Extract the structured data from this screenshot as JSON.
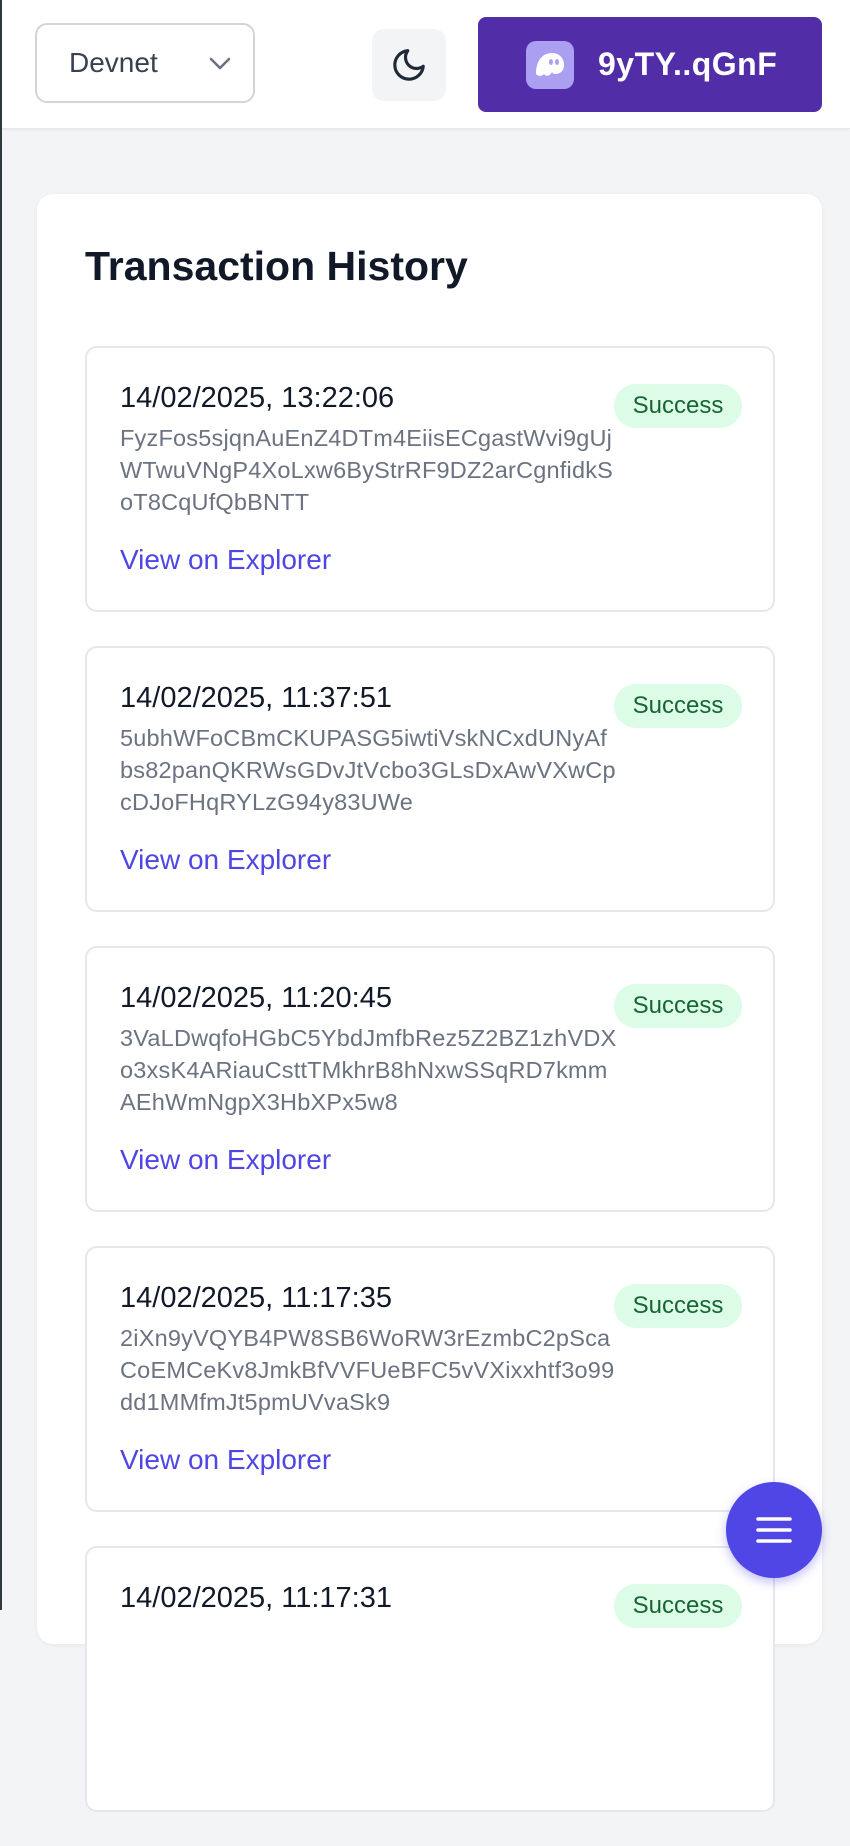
{
  "header": {
    "network_selector": {
      "value": "Devnet",
      "icon": "chevron-down-icon"
    },
    "theme_toggle": {
      "icon": "moon-icon"
    },
    "wallet": {
      "label": "9yTY..qGnF",
      "icon": "phantom-wallet-icon",
      "bg_color": "#512da8"
    }
  },
  "main": {
    "title": "Transaction History",
    "transactions": [
      {
        "date": "14/02/2025, 13:22:06",
        "signature": "FyzFos5sjqnAuEnZ4DTm4EiisECgastWvi9gUjWTwuVNgP4XoLxw6ByStrRF9DZ2arCgnfidkSoT8CqUfQbBNTT",
        "status": "Success",
        "link_label": "View on Explorer"
      },
      {
        "date": "14/02/2025, 11:37:51",
        "signature": "5ubhWFoCBmCKUPASG5iwtiVskNCxdUNyAfbs82panQKRWsGDvJtVcbo3GLsDxAwVXwCpcDJoFHqRYLzG94y83UWe",
        "status": "Success",
        "link_label": "View on Explorer"
      },
      {
        "date": "14/02/2025, 11:20:45",
        "signature": "3VaLDwqfoHGbC5YbdJmfbRez5Z2BZ1zhVDXo3xsK4ARiauCsttTMkhrB8hNxwSSqRD7kmmAEhWmNgpX3HbXPx5w8",
        "status": "Success",
        "link_label": "View on Explorer"
      },
      {
        "date": "14/02/2025, 11:17:35",
        "signature": "2iXn9yVQYB4PW8SB6WoRW3rEzmbC2pScaCoEMCeKv8JmkBfVVFUeBFC5vVXixxhtf3o99dd1MMfmJt5pmUVvaSk9",
        "status": "Success",
        "link_label": "View on Explorer"
      },
      {
        "date": "14/02/2025, 11:17:31",
        "signature": "",
        "status": "Success",
        "link_label": ""
      }
    ]
  },
  "fab": {
    "icon": "hamburger-menu-icon",
    "color": "#4f46e5"
  },
  "colors": {
    "accent": "#4f46e5",
    "success_bg": "#dcfce7",
    "success_text": "#166534"
  }
}
